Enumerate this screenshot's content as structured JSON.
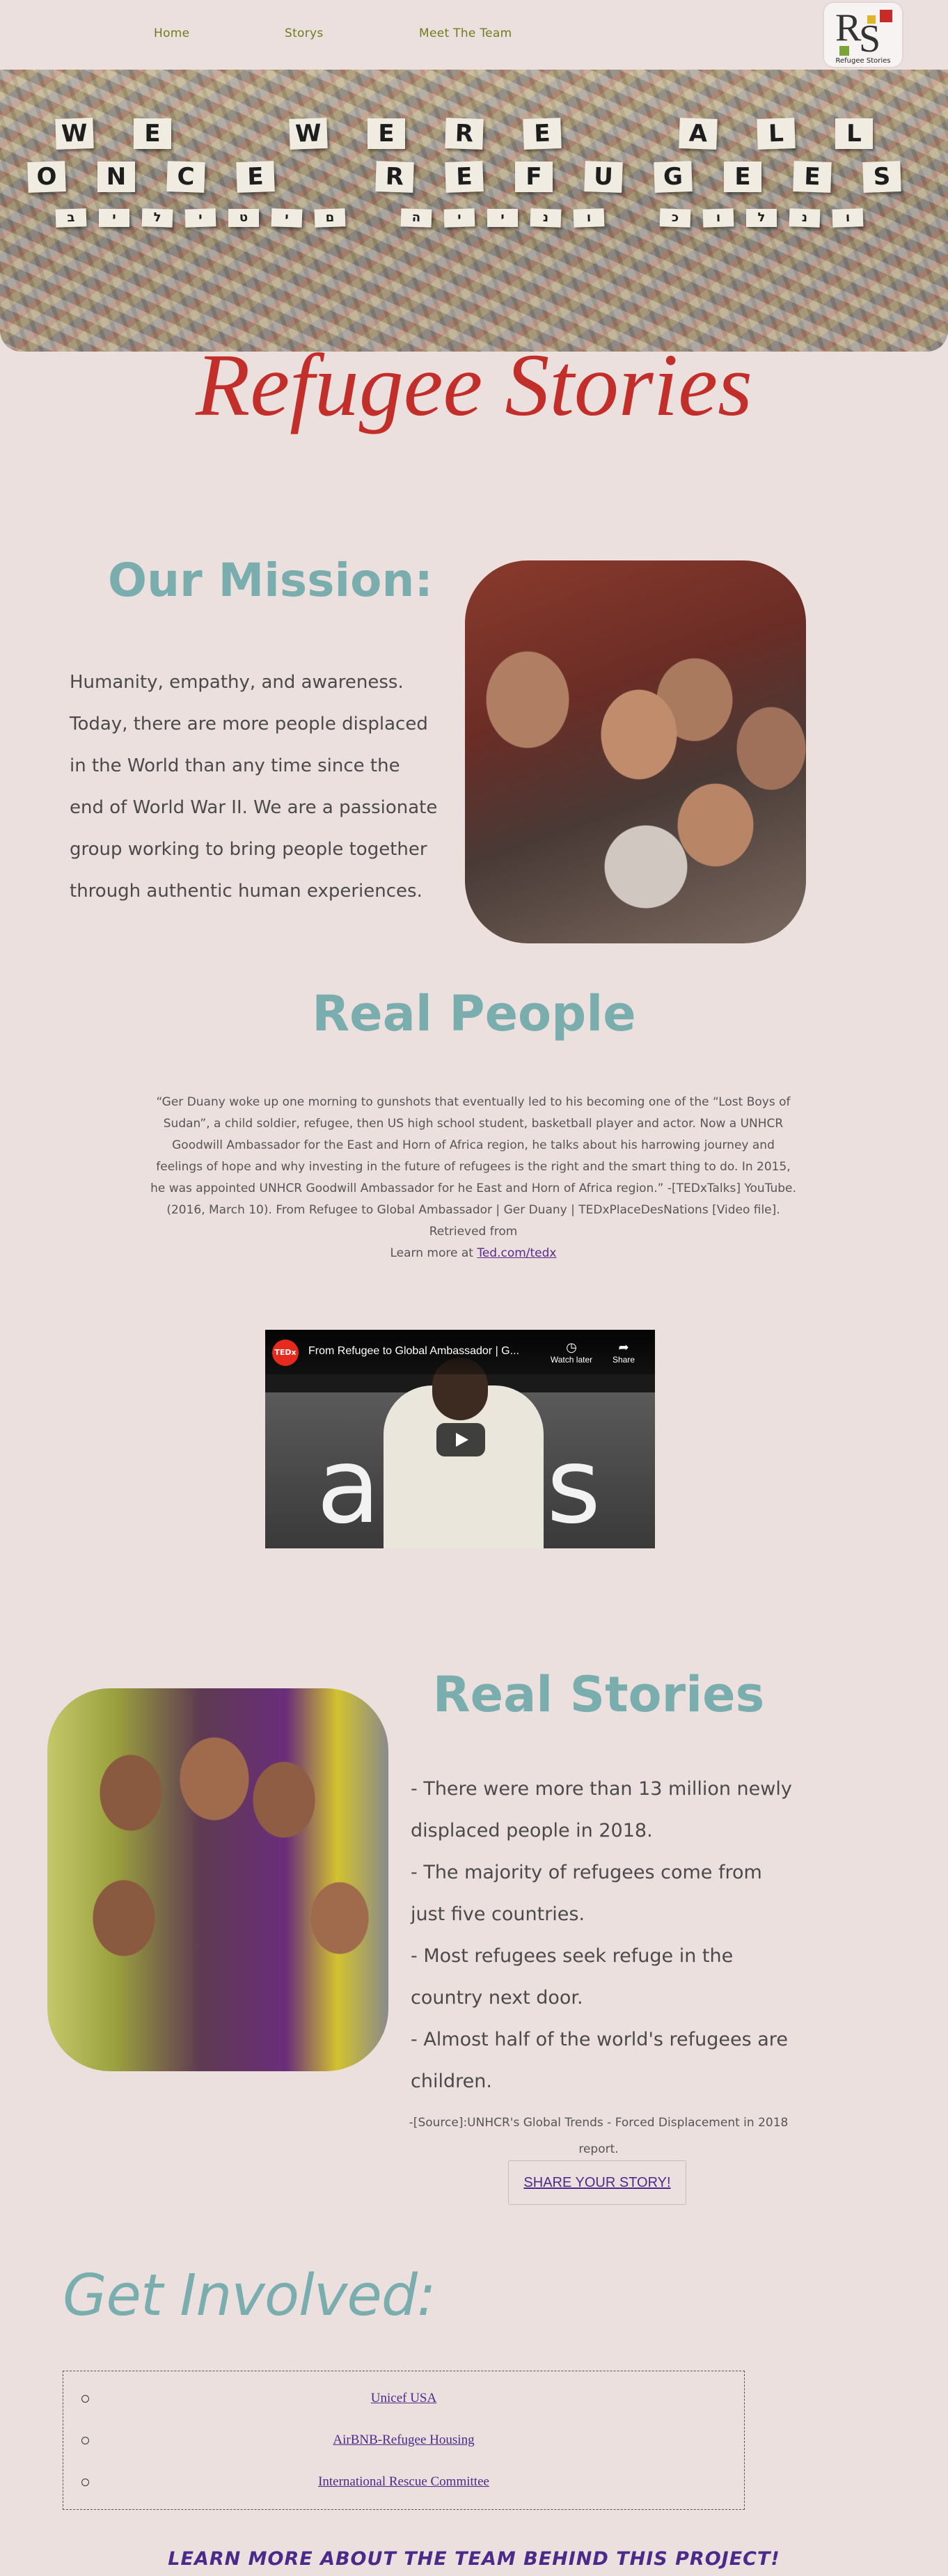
{
  "nav": {
    "links": [
      "Home",
      "Storys",
      "Meet The Team"
    ]
  },
  "logo": {
    "letters": "RS",
    "r": "R",
    "s": "S",
    "caption": "Refugee Stories"
  },
  "hero": {
    "line1": [
      "W",
      "E",
      " ",
      "W",
      "E",
      "R",
      "E",
      " ",
      "A",
      "L",
      "L"
    ],
    "line2": [
      "O",
      "N",
      "C",
      "E",
      " ",
      "R",
      "E",
      "F",
      "U",
      "G",
      "E",
      "E",
      "S"
    ],
    "hebrew": [
      "ב",
      "י",
      "ל",
      "י",
      "ט",
      "י",
      "ם",
      " ",
      "ה",
      "י",
      "י",
      "נ",
      "ו",
      " ",
      "כ",
      "ו",
      "ל",
      "נ",
      "ו"
    ]
  },
  "site_title": "Refugee Stories",
  "mission": {
    "heading": "Our Mission:",
    "text": "Humanity, empathy, and awareness. Today, there are more people displaced in the World than any time since the end of World War II. We are a passionate group working to bring people together through authentic human experiences."
  },
  "real_people": {
    "heading": "Real People",
    "quote": "“Ger Duany woke up one morning to gunshots that eventually led to his becoming one of the “Lost Boys of Sudan”, a child soldier, refugee, then US high school student, basketball player and actor. Now a UNHCR Goodwill Ambassador for the East and Horn of Africa region, he talks about his harrowing journey and feelings of hope and why investing in the future of refugees is the right and the smart thing to do. In 2015, he was appointed UNHCR Goodwill Ambassador for he East and Horn of Africa region.” -[TEDxTalks] YouTube. (2016, March 10). From Refugee to Global Ambassador | Ger Duany | TEDxPlaceDesNations [Video file]. Retrieved from",
    "learn_more": "Learn more at ",
    "learn_more_link": "Ted.com/tedx"
  },
  "video": {
    "title": "From Refugee to Global Ambassador | G...",
    "ted_badge": "TEDx",
    "watch_later": "Watch later",
    "share": "Share",
    "background_text": "ac  es"
  },
  "real_stories": {
    "heading": "Real Stories",
    "facts": [
      "- There were more than 13 million newly displaced people in 2018.",
      "- The majority of refugees come from just five countries.",
      "- Most refugees seek refuge in the country next door.",
      "- Almost half of the world's refugees are children."
    ],
    "source": "-[Source]:UNHCR's Global Trends - Forced Displacement in 2018 report.",
    "share_button": "SHARE YOUR STORY!"
  },
  "get_involved": {
    "heading": "Get Involved:",
    "links": [
      "Unicef USA",
      "AirBNB-Refugee Housing",
      "International Rescue Committee"
    ]
  },
  "team_link": "LEARN MORE ABOUT THE TEAM BEHIND THIS PROJECT!"
}
